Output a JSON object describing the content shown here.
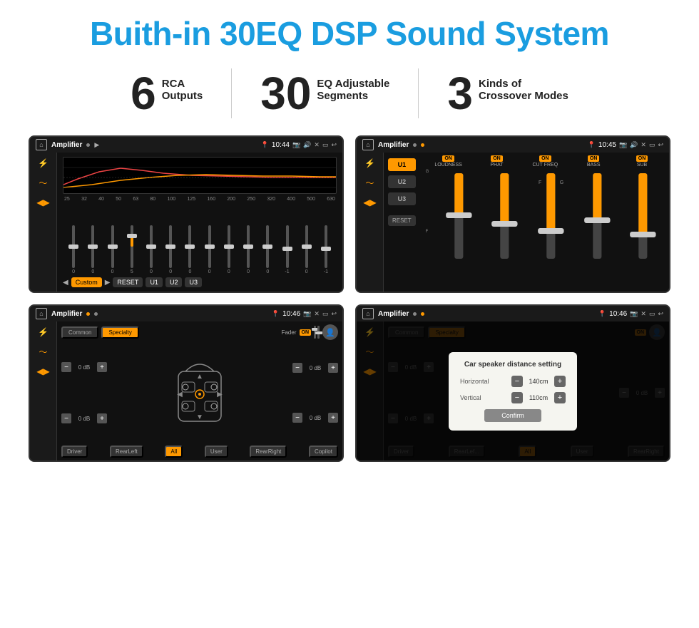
{
  "page": {
    "title": "Buith-in 30EQ DSP Sound System",
    "stats": [
      {
        "number": "6",
        "label_line1": "RCA",
        "label_line2": "Outputs"
      },
      {
        "number": "30",
        "label_line1": "EQ Adjustable",
        "label_line2": "Segments"
      },
      {
        "number": "3",
        "label_line1": "Kinds of",
        "label_line2": "Crossover Modes"
      }
    ]
  },
  "screens": {
    "eq_screen": {
      "status_title": "Amplifier",
      "time": "10:44",
      "freqs": [
        "25",
        "32",
        "40",
        "50",
        "63",
        "80",
        "100",
        "125",
        "160",
        "200",
        "250",
        "320",
        "400",
        "500",
        "630"
      ],
      "sliders": [
        0,
        0,
        0,
        5,
        0,
        0,
        0,
        0,
        0,
        0,
        0,
        -1,
        0,
        -1
      ],
      "buttons": [
        "Custom",
        "RESET",
        "U1",
        "U2",
        "U3"
      ]
    },
    "crossover_screen": {
      "status_title": "Amplifier",
      "time": "10:45",
      "u_buttons": [
        "U1",
        "U2",
        "U3"
      ],
      "channels": [
        {
          "on": true,
          "name": "LOUDNESS"
        },
        {
          "on": true,
          "name": "PHAT"
        },
        {
          "on": true,
          "name": "CUT FREQ"
        },
        {
          "on": true,
          "name": "BASS"
        },
        {
          "on": true,
          "name": "SUB"
        }
      ],
      "reset_label": "RESET"
    },
    "car_speaker_screen": {
      "status_title": "Amplifier",
      "time": "10:46",
      "tabs": [
        "Common",
        "Specialty"
      ],
      "fader_label": "Fader",
      "fader_on": "ON",
      "controls": {
        "left_top_db": "0 dB",
        "left_bottom_db": "0 dB",
        "right_top_db": "0 dB",
        "right_bottom_db": "0 dB"
      },
      "bottom_buttons": [
        "Driver",
        "RearLeft",
        "All",
        "User",
        "RearRight",
        "Copilot"
      ]
    },
    "car_speaker_dialog_screen": {
      "status_title": "Amplifier",
      "time": "10:46",
      "tabs": [
        "Common",
        "Specialty"
      ],
      "dialog": {
        "title": "Car speaker distance setting",
        "horizontal_label": "Horizontal",
        "horizontal_value": "140cm",
        "vertical_label": "Vertical",
        "vertical_value": "110cm",
        "confirm_label": "Confirm"
      }
    }
  }
}
